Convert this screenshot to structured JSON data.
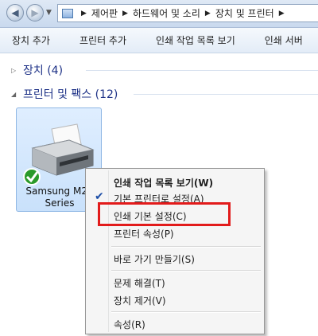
{
  "breadcrumb": {
    "items": [
      "제어판",
      "하드웨어 및 소리",
      "장치 및 프린터"
    ]
  },
  "toolbar": {
    "items": [
      "장치 추가",
      "프린터 추가",
      "인쇄 작업 목록 보기",
      "인쇄 서버"
    ]
  },
  "groups": {
    "devices": "장치 (4)",
    "printers": "프린터 및 팩스 (12)"
  },
  "printer": {
    "name_line1": "Samsung M20",
    "name_line2": "Series",
    "default_status_color": "#2a9a2a"
  },
  "context_menu": {
    "items": [
      "인쇄 작업 목록 보기(W)",
      "기본 프린터로 설정(A)",
      "인쇄 기본 설정(C)",
      "프린터 속성(P)",
      "바로 가기 만들기(S)",
      "문제 해결(T)",
      "장치 제거(V)",
      "속성(R)"
    ],
    "checked_item": "기본 프린터로 설정(A)",
    "highlighted_item": "인쇄 기본 설정(C)",
    "highlight_color": "#e21b1b"
  }
}
